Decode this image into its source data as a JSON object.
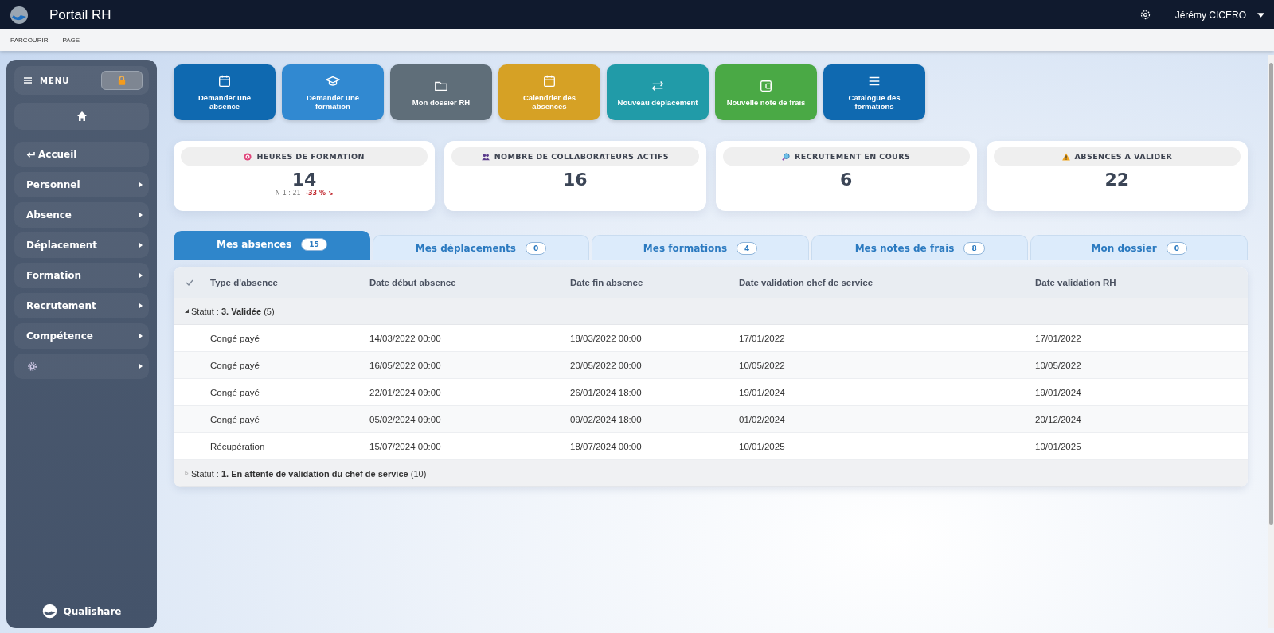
{
  "header": {
    "title": "Portail RH",
    "user": "Jérémy CICERO"
  },
  "subnav": [
    "PARCOURIR",
    "PAGE"
  ],
  "sidebar": {
    "menu_label": "MENU",
    "locked": true,
    "footer": "Qualishare",
    "items": [
      {
        "kind": "back",
        "label": "Accueil"
      },
      {
        "kind": "submenu",
        "label": "Personnel"
      },
      {
        "kind": "submenu",
        "label": "Absence"
      },
      {
        "kind": "submenu",
        "label": "Déplacement"
      },
      {
        "kind": "submenu",
        "label": "Formation"
      },
      {
        "kind": "submenu",
        "label": "Recrutement"
      },
      {
        "kind": "submenu",
        "label": "Compétence"
      },
      {
        "kind": "settings"
      }
    ]
  },
  "quick_actions": [
    {
      "label": "Demander une absence",
      "color": "#0f69b0"
    },
    {
      "label": "Demander une formation",
      "color": "#3189d1"
    },
    {
      "label": "Mon dossier RH",
      "color": "#5f6e79"
    },
    {
      "label": "Calendrier des absences",
      "color": "#d6a125"
    },
    {
      "label": "Nouveau déplacement",
      "color": "#219ba8"
    },
    {
      "label": "Nouvelle note de frais",
      "color": "#4aa945"
    },
    {
      "label": "Catalogue des formations",
      "color": "#0f69b0"
    }
  ],
  "stats": [
    {
      "title": "HEURES DE FORMATION",
      "value": "14",
      "previous": "N-1 : 21",
      "trend": "-33 % ↘"
    },
    {
      "title": "NOMBRE DE COLLABORATEURS ACTIFS",
      "value": "16"
    },
    {
      "title": "RECRUTEMENT EN COURS",
      "value": "6"
    },
    {
      "title": "ABSENCES A VALIDER",
      "value": "22"
    }
  ],
  "tabs": [
    {
      "label": "Mes absences",
      "count": "15",
      "selected": true
    },
    {
      "label": "Mes déplacements",
      "count": "0",
      "selected": false
    },
    {
      "label": "Mes formations",
      "count": "4",
      "selected": false
    },
    {
      "label": "Mes notes de frais",
      "count": "8",
      "selected": false
    },
    {
      "label": "Mon dossier",
      "count": "0",
      "selected": false
    }
  ],
  "table": {
    "columns": [
      "Type d'absence",
      "Date début absence",
      "Date fin absence",
      "Date validation chef de service",
      "Date validation RH"
    ],
    "groups": [
      {
        "prefix": "Statut :",
        "status": "3. Validée",
        "count": "(5)",
        "expanded": true,
        "rows": [
          [
            "Congé payé",
            "14/03/2022 00:00",
            "18/03/2022 00:00",
            "17/01/2022",
            "17/01/2022"
          ],
          [
            "Congé payé",
            "16/05/2022 00:00",
            "20/05/2022 00:00",
            "10/05/2022",
            "10/05/2022"
          ],
          [
            "Congé payé",
            "22/01/2024 09:00",
            "26/01/2024 18:00",
            "19/01/2024",
            "19/01/2024"
          ],
          [
            "Congé payé",
            "05/02/2024 09:00",
            "09/02/2024 18:00",
            "01/02/2024",
            "20/12/2024"
          ],
          [
            "Récupération",
            "15/07/2024 00:00",
            "18/07/2024 00:00",
            "10/01/2025",
            "10/01/2025"
          ]
        ]
      },
      {
        "prefix": "Statut :",
        "status": "1. En attente de validation du chef de service",
        "count": "(10)",
        "expanded": false
      }
    ]
  }
}
